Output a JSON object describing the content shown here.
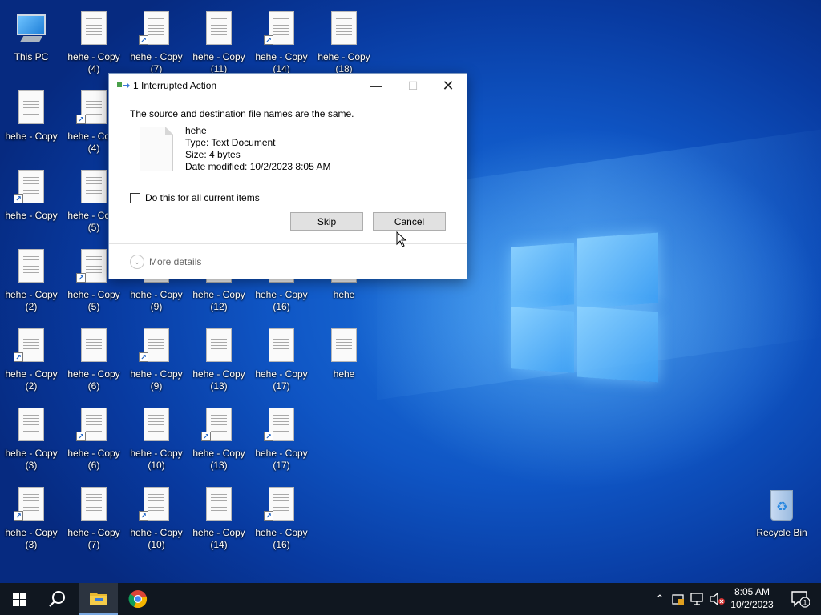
{
  "desktop": {
    "this_pc_label": "This PC",
    "recycle_bin_label": "Recycle Bin",
    "files": [
      "hehe - Copy\n(4)",
      "hehe - Copy\n(7)",
      "hehe - Copy\n(11)",
      "hehe - Copy\n(14)",
      "hehe - Copy\n(18)",
      "hehe - Copy",
      "hehe - Copy\n(4)",
      "hehe - Copy",
      "hehe - Copy\n(5)",
      "hehe - Copy\n(2)",
      "hehe - Copy\n(5)",
      "hehe - Copy\n(9)",
      "hehe - Copy\n(12)",
      "hehe - Copy\n(16)",
      "hehe",
      "hehe - Copy\n(2)",
      "hehe - Copy\n(6)",
      "hehe - Copy\n(9)",
      "hehe - Copy\n(13)",
      "hehe - Copy\n(17)",
      "hehe",
      "hehe - Copy\n(3)",
      "hehe - Copy\n(6)",
      "hehe - Copy\n(10)",
      "hehe - Copy\n(13)",
      "hehe - Copy\n(17)",
      "hehe - Copy\n(3)",
      "hehe - Copy\n(7)",
      "hehe - Copy\n(10)",
      "hehe - Copy\n(14)",
      "hehe - Copy\n(16)"
    ]
  },
  "dialog": {
    "title": "1 Interrupted Action",
    "message": "The source and destination file names are the same.",
    "file_name": "hehe",
    "file_type": "Type: Text Document",
    "file_size": "Size: 4 bytes",
    "file_modified": "Date modified: 10/2/2023 8:05 AM",
    "checkbox_label": "Do this for all current items",
    "skip_label": "Skip",
    "cancel_label": "Cancel",
    "more_details_label": "More details"
  },
  "taskbar": {
    "time": "8:05 AM",
    "date": "10/2/2023",
    "notification_count": "1"
  }
}
